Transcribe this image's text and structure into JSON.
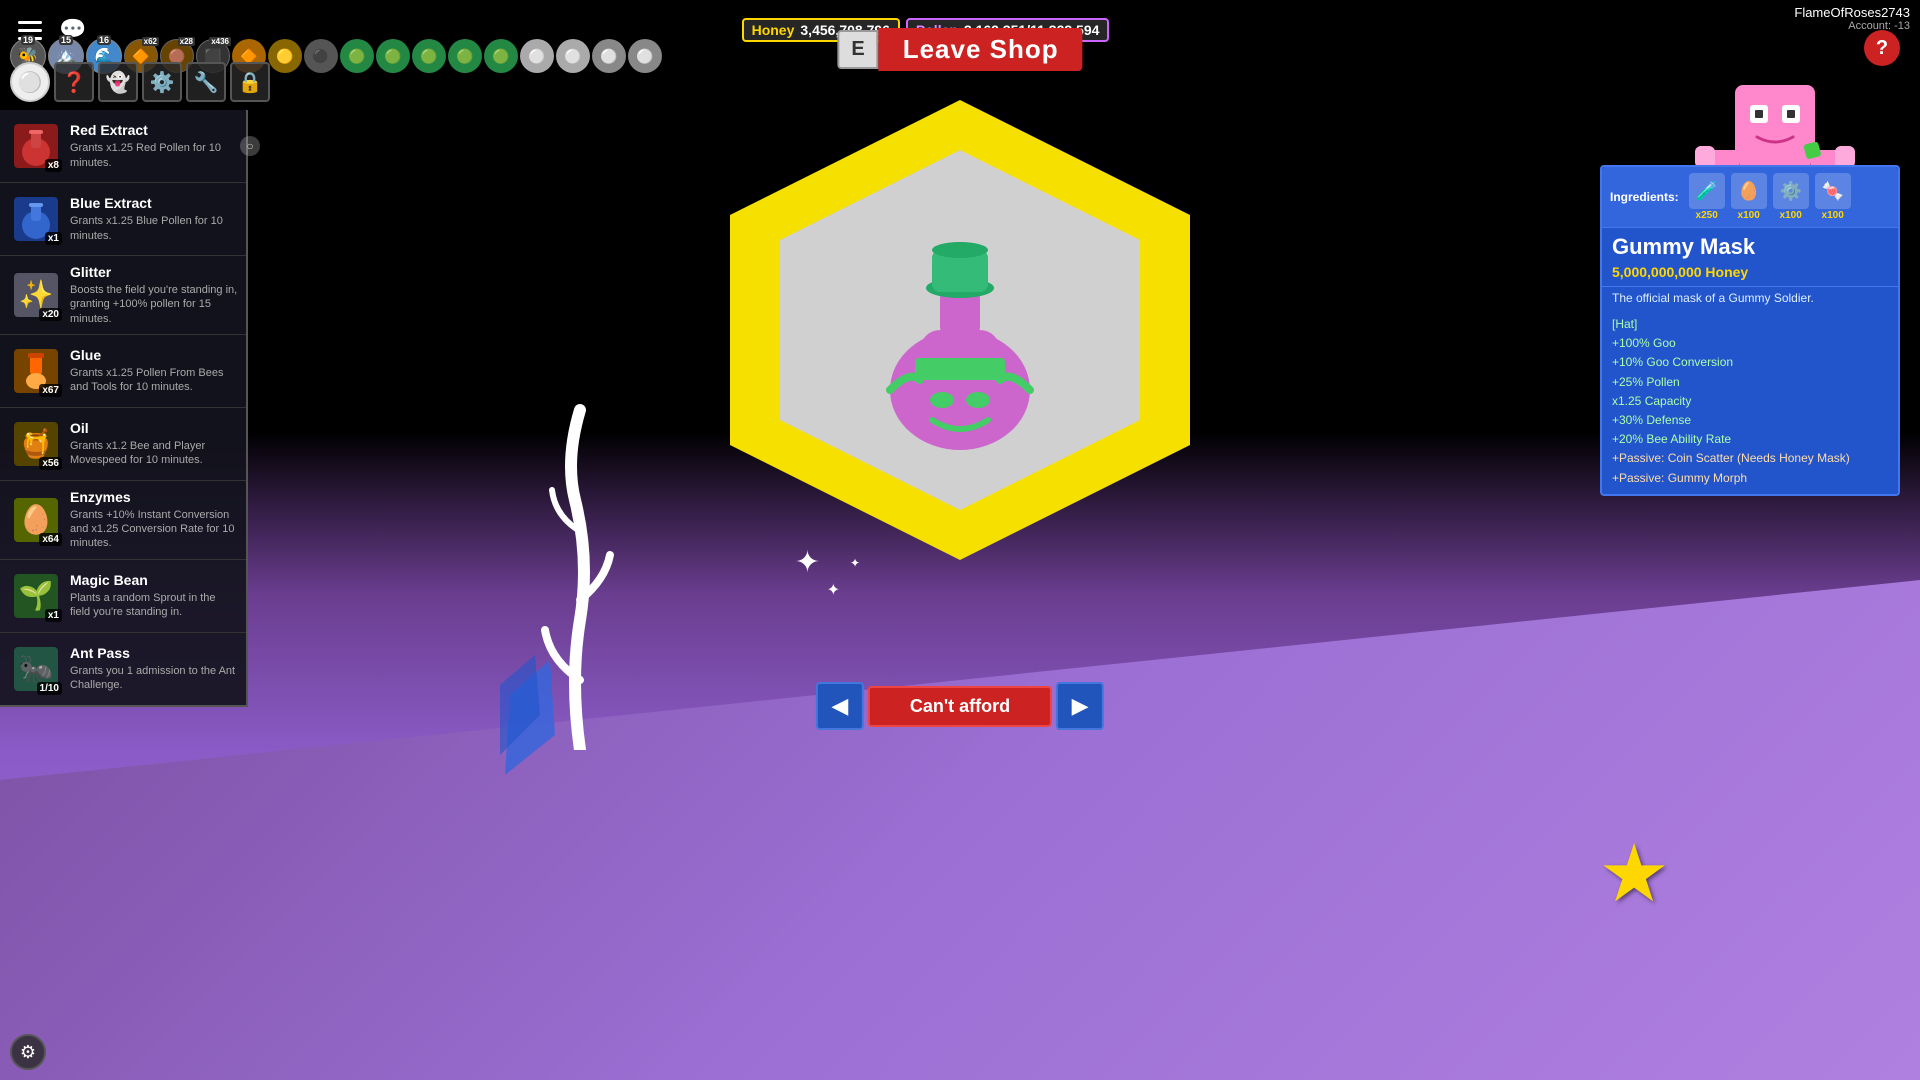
{
  "topbar": {
    "honey_label": "Honey",
    "honey_value": "3,456,708,796",
    "pollen_label": "Pollen",
    "pollen_current": "3,162,351",
    "pollen_max": "11,323,594",
    "pollen_display": "3,162,351/11,323,594",
    "username": "FlameOfRoses2743",
    "account": "Account: -13"
  },
  "leave_shop": {
    "key": "E",
    "label": "Leave Shop"
  },
  "shop_items": [
    {
      "name": "Red Extract",
      "desc": "Grants x1.25 Red Pollen for 10 minutes.",
      "icon": "🧪",
      "icon_color": "#cc3333",
      "count": "x8"
    },
    {
      "name": "Blue Extract",
      "desc": "Grants x1.25 Blue Pollen for 10 minutes.",
      "icon": "🧪",
      "icon_color": "#3366cc",
      "count": "x1"
    },
    {
      "name": "Glitter",
      "desc": "Boosts the field you're standing in, granting +100% pollen for 15 minutes.",
      "icon": "✨",
      "icon_color": "#aaaacc",
      "count": "x20"
    },
    {
      "name": "Glue",
      "desc": "Grants x1.25 Pollen From Bees and Tools for 10 minutes.",
      "icon": "🔧",
      "icon_color": "#ff6600",
      "count": "x67"
    },
    {
      "name": "Oil",
      "desc": "Grants x1.2 Bee and Player Movespeed for 10 minutes.",
      "icon": "🍯",
      "icon_color": "#aa6600",
      "count": "x56"
    },
    {
      "name": "Enzymes",
      "desc": "Grants +10% Instant Conversion and x1.25 Conversion Rate for 10 minutes.",
      "icon": "🥚",
      "icon_color": "#aacc44",
      "count": "x64"
    },
    {
      "name": "Magic Bean",
      "desc": "Plants a random Sprout in the field you're standing in.",
      "icon": "🌱",
      "icon_color": "#44aa44",
      "count": "x1"
    },
    {
      "name": "Ant Pass",
      "desc": "Grants you 1 admission to the Ant Challenge.",
      "icon": "🐜",
      "icon_color": "#44aa44",
      "count": "1/10"
    }
  ],
  "featured_item": {
    "name": "Gummy Mask",
    "price": "5,000,000,000 Honey",
    "description": "The official mask of a Gummy Soldier.",
    "type": "[Hat]",
    "stats": [
      "+100% Goo",
      "+10% Goo Conversion",
      "+25% Pollen",
      "x1.25 Capacity",
      "+30% Defense",
      "+20% Bee Ability Rate",
      "+Passive: Coin Scatter (Needs Honey Mask)",
      "+Passive: Gummy Morph"
    ],
    "ingredients_label": "Ingredients:",
    "ingredients": [
      {
        "icon": "🧪",
        "count": "x250"
      },
      {
        "icon": "🥚",
        "count": "x100"
      },
      {
        "icon": "⚙️",
        "count": "x100"
      },
      {
        "icon": "🍬",
        "count": "x100"
      }
    ]
  },
  "purchase": {
    "cant_afford_label": "Can't afford",
    "prev_arrow": "◀",
    "next_arrow": "▶"
  },
  "levels": [
    {
      "num": "19",
      "icon": "🐝"
    },
    {
      "num": "15",
      "icon": "🏔️"
    },
    {
      "num": "16",
      "icon": "🌊"
    }
  ],
  "toolbar_icons": [
    {
      "icon": "⚪",
      "name": "egg-icon"
    },
    {
      "icon": "❓",
      "name": "help-icon"
    },
    {
      "icon": "👻",
      "name": "ghost-icon"
    },
    {
      "icon": "⚙️",
      "name": "gear-icon"
    },
    {
      "icon": "⚙️",
      "name": "settings-icon"
    },
    {
      "icon": "🔒",
      "name": "lock-icon"
    }
  ]
}
